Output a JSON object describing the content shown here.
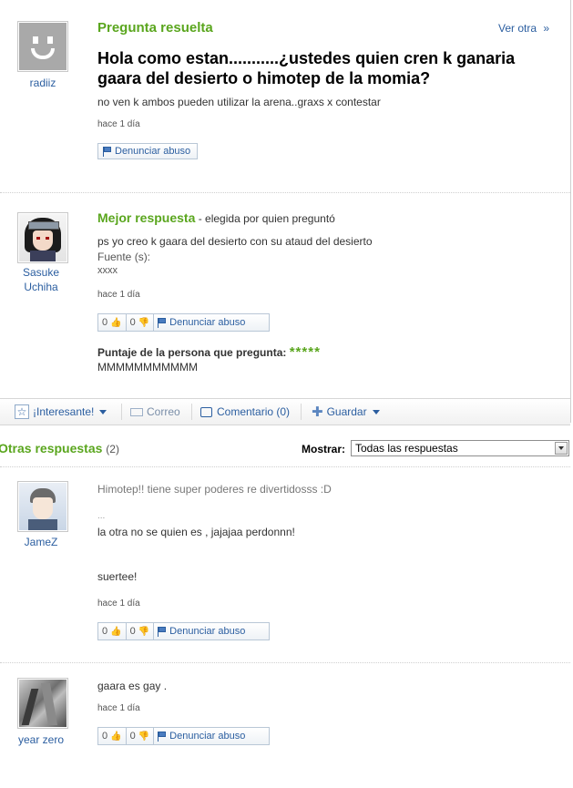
{
  "question": {
    "header": "Pregunta resuelta",
    "ver_otra": "Ver otra",
    "ver_otra_arrow": "»",
    "title_line1": "Hola como estan...........¿ustedes quien cren k ganaria",
    "title_line2": "gaara del desierto o himotep de la momia?",
    "details": "no ven k ambos pueden utilizar la arena..graxs x contestar",
    "time": "hace 1 día",
    "user": "radiiz",
    "report_label": "Denunciar abuso"
  },
  "best_answer": {
    "header": "Mejor respuesta",
    "chosen_by": " - elegida por quien preguntó",
    "text": "ps yo creo k gaara del desierto con su ataud del desierto",
    "source_label": "Fuente (s):",
    "source_value": "xxxx",
    "time": "hace 1 día",
    "user_line1": "Sasuke",
    "user_line2": "Uchiha",
    "thumbs_up": "0",
    "thumbs_down": "0",
    "report_label": "Denunciar abuso",
    "rating_label": "Puntaje de la persona que pregunta:",
    "rating_stars": "*****",
    "rating_comment": "MMMMMMMMMMM"
  },
  "action_bar": {
    "interesante": "¡Interesante!",
    "correo": "Correo",
    "comentario": "Comentario (0)",
    "guardar": "Guardar"
  },
  "other_answers": {
    "header": "Otras respuestas",
    "count": "(2)",
    "mostrar_label": "Mostrar:",
    "mostrar_value": "Todas las respuestas",
    "answers": [
      {
        "user": "JameZ",
        "line1": "Himotep!! tiene super poderes re divertidosss :D",
        "line2": "...",
        "line3": "la otra no se quien es , jajajaa perdonnn!",
        "line4": "suertee!",
        "time": "hace 1 día",
        "thumbs_up": "0",
        "thumbs_down": "0",
        "report_label": "Denunciar abuso"
      },
      {
        "user": "year zero",
        "line1": "gaara es gay .",
        "time": "hace 1 día",
        "thumbs_up": "0",
        "thumbs_down": "0",
        "report_label": "Denunciar abuso"
      }
    ]
  },
  "colors": {
    "accent_green": "#5aa61e",
    "link_blue": "#2b5ea0"
  }
}
